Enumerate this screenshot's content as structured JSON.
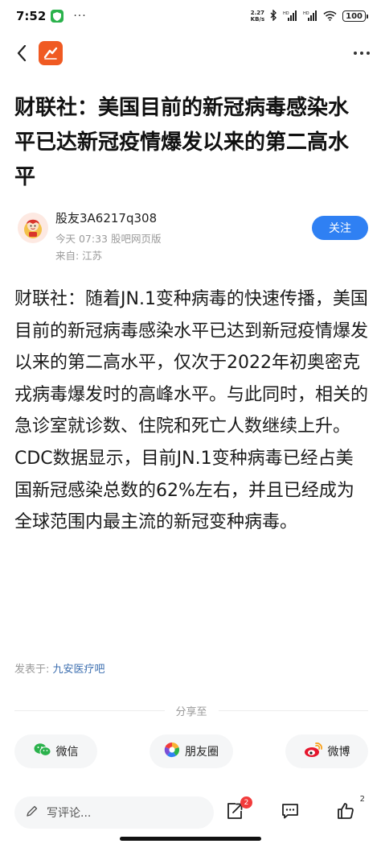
{
  "status_bar": {
    "time": "7:52",
    "dots": "···",
    "speed_value": "2.27",
    "speed_unit": "KB/s",
    "battery": "100"
  },
  "article": {
    "title": "财联社：美国目前的新冠病毒感染水平已达新冠疫情爆发以来的第二高水平",
    "author_name": "股友3A6217q308",
    "post_time": "今天 07:33 股吧网页版",
    "location": "来自: 江苏",
    "follow_label": "关注",
    "body": "财联社：随着JN.1变种病毒的快速传播，美国目前的新冠病毒感染水平已达到新冠疫情爆发以来的第二高水平，仅次于2022年初奥密克戎病毒爆发时的高峰水平。与此同时，相关的急诊室就诊数、住院和死亡人数继续上升。CDC数据显示，目前JN.1变种病毒已经占美国新冠感染总数的62%左右，并且已经成为全球范围内最主流的新冠变种病毒。",
    "posted_in_label": "发表于:",
    "forum_name": "九安医疗吧"
  },
  "share": {
    "label": "分享至",
    "wechat": "微信",
    "moments": "朋友圈",
    "weibo": "微博"
  },
  "bottom_bar": {
    "comment_placeholder": "写评论...",
    "share_badge": "2",
    "like_count": "2"
  },
  "colors": {
    "accent_blue": "#2f80f3",
    "app_logo": "#f05a22",
    "badge_red": "#f23b3b"
  }
}
